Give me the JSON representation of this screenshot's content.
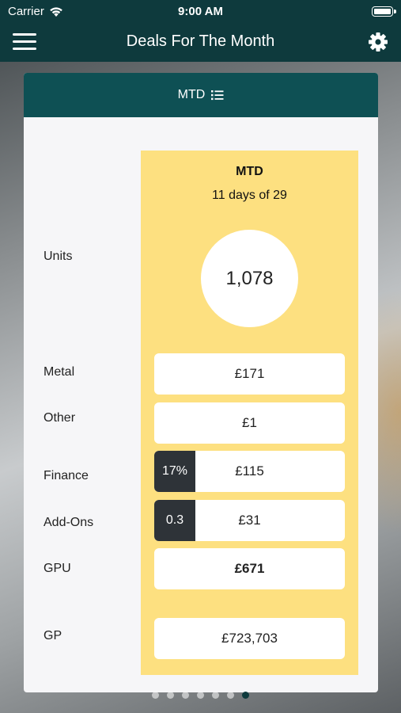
{
  "status_bar": {
    "carrier": "Carrier",
    "time": "9:00 AM"
  },
  "nav": {
    "title": "Deals For The Month",
    "menu_icon": "hamburger-icon",
    "settings_icon": "gear-icon"
  },
  "card": {
    "header_label": "MTD",
    "period_title": "MTD",
    "period_subtitle": "11 days of 29",
    "labels": {
      "units": "Units",
      "metal": "Metal",
      "other": "Other",
      "finance": "Finance",
      "addons": "Add-Ons",
      "gpu": "GPU",
      "gp": "GP"
    },
    "values": {
      "units": "1,078",
      "metal": "£171",
      "other": "£1",
      "finance": "£115",
      "finance_badge": "17%",
      "addons": "£31",
      "addons_badge": "0.3",
      "gpu": "£671",
      "gp": "£723,703"
    }
  },
  "pagination": {
    "total": 7,
    "active_index": 6
  },
  "colors": {
    "nav": "#0e3a3d",
    "header": "#0e5054",
    "panel": "#fde080",
    "badge": "#2e3338"
  }
}
